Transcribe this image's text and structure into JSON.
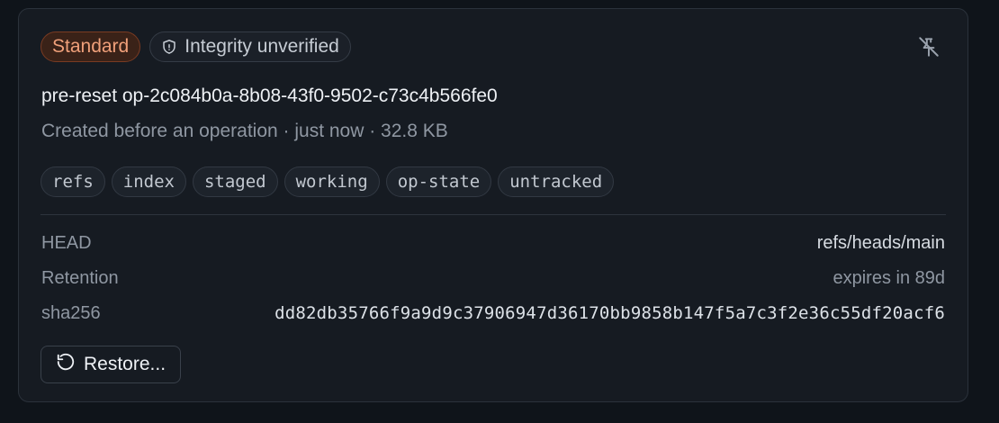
{
  "badges": {
    "level": "Standard",
    "integrity": "Integrity unverified"
  },
  "icons": {
    "integrity": "shield-icon",
    "unpin": "pin-off-icon",
    "restore": "rotate-ccw-icon"
  },
  "snapshot": {
    "title": "pre-reset op-2c084b0a-8b08-43f0-9502-c73c4b566fe0",
    "subtitle": "Created before an operation · just now · 32.8 KB"
  },
  "chips": [
    "refs",
    "index",
    "staged",
    "working",
    "op-state",
    "untracked"
  ],
  "details": {
    "head_label": "HEAD",
    "head_value": "refs/heads/main",
    "retention_label": "Retention",
    "retention_value": "expires in 89d",
    "sha_label": "sha256",
    "sha_value": "dd82db35766f9a9d9c37906947d36170bb9858b147f5a7c3f2e36c55df20acf6"
  },
  "actions": {
    "restore_label": "Restore..."
  },
  "colors": {
    "background": "#0f141a",
    "card": "#161b22",
    "badge_standard_text": "#f0a07a",
    "badge_standard_bg": "#3a2218"
  }
}
